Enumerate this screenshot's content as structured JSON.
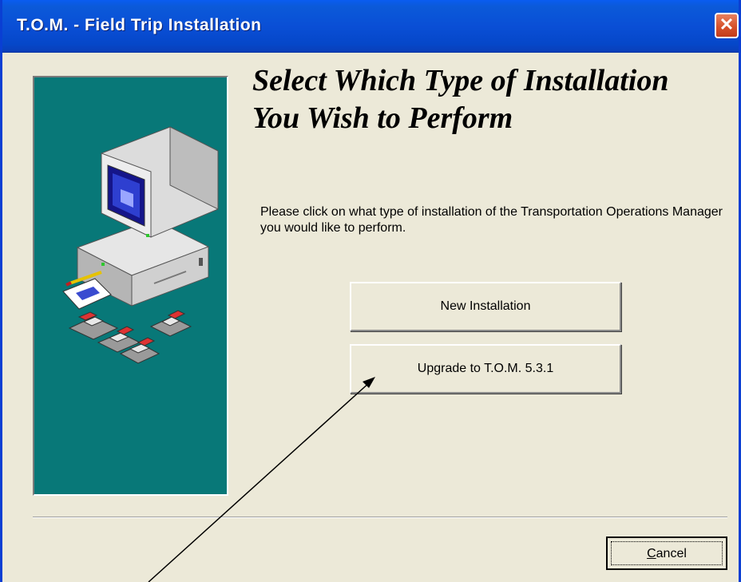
{
  "window": {
    "title": "T.O.M. - Field Trip Installation",
    "close_glyph": "✕"
  },
  "main": {
    "heading": "Select Which Type of Installation You Wish to Perform",
    "description": "Please click on what type of installation of the Transportation Operations Manager you would like to perform."
  },
  "buttons": {
    "new_installation": "New Installation",
    "upgrade": "Upgrade to T.O.M. 5.3.1",
    "cancel_prefix": "C",
    "cancel_rest": "ancel"
  },
  "icons": {
    "side_art": "computer-with-disks-icon",
    "close": "close-icon",
    "annotation": "arrow-annotation"
  },
  "colors": {
    "titlebar": "#0a4fd6",
    "panel": "#087878",
    "dialog_bg": "#ece9d8",
    "close_button": "#d7522c"
  }
}
